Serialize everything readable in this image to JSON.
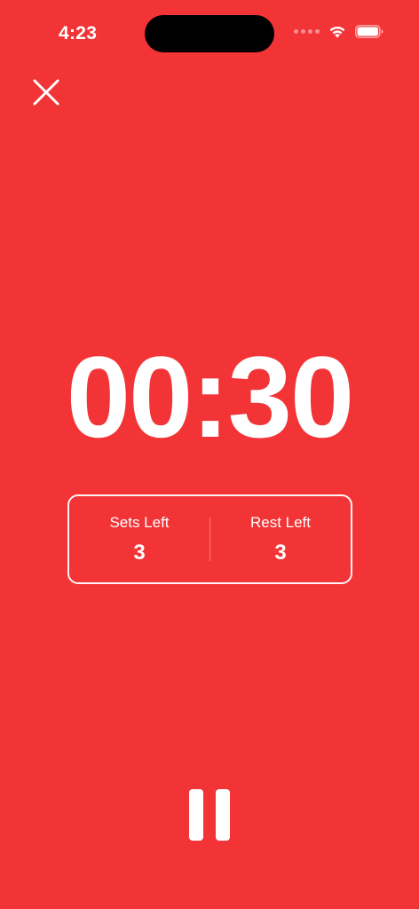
{
  "status_bar": {
    "time": "4:23"
  },
  "timer": {
    "display": "00:30"
  },
  "stats": {
    "sets_left_label": "Sets Left",
    "sets_left_value": "3",
    "rest_left_label": "Rest Left",
    "rest_left_value": "3"
  },
  "icons": {
    "close": "close-icon",
    "pause": "pause-icon",
    "wifi": "wifi-icon",
    "battery": "battery-icon"
  },
  "colors": {
    "background": "#F23437",
    "foreground": "#FFFFFF"
  }
}
